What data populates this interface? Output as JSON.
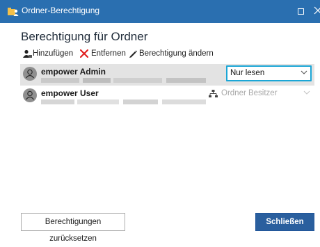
{
  "window": {
    "title": "Ordner-Berechtigung",
    "icons": {
      "app": "folder-users-icon",
      "maximize": "maximize-icon",
      "close": "close-icon"
    },
    "colors": {
      "titlebar": "#2a6fb0",
      "accent": "#1ba6d6",
      "primary_button": "#2a5f9e",
      "selected_row": "#e3e3e3"
    }
  },
  "heading": "Berechtigung für Ordner",
  "toolbar": {
    "add_label": "Hinzufügen",
    "remove_label": "Entfernen",
    "change_label": "Berechtigung ändern",
    "icons": {
      "add": "add-user-icon",
      "remove": "x-icon",
      "change": "pencil-icon"
    }
  },
  "entries": [
    {
      "name": "empower Admin",
      "permission": "Nur lesen",
      "selected": true,
      "icon": "user-icon"
    },
    {
      "name": "empower User",
      "permission": "Ordner Besitzer",
      "selected": false,
      "disabled": true,
      "icon": "user-icon",
      "permission_icon": "network-icon"
    }
  ],
  "buttons": {
    "reset_label": "Berechtigungen zurücksetzen",
    "close_label": "Schließen"
  }
}
